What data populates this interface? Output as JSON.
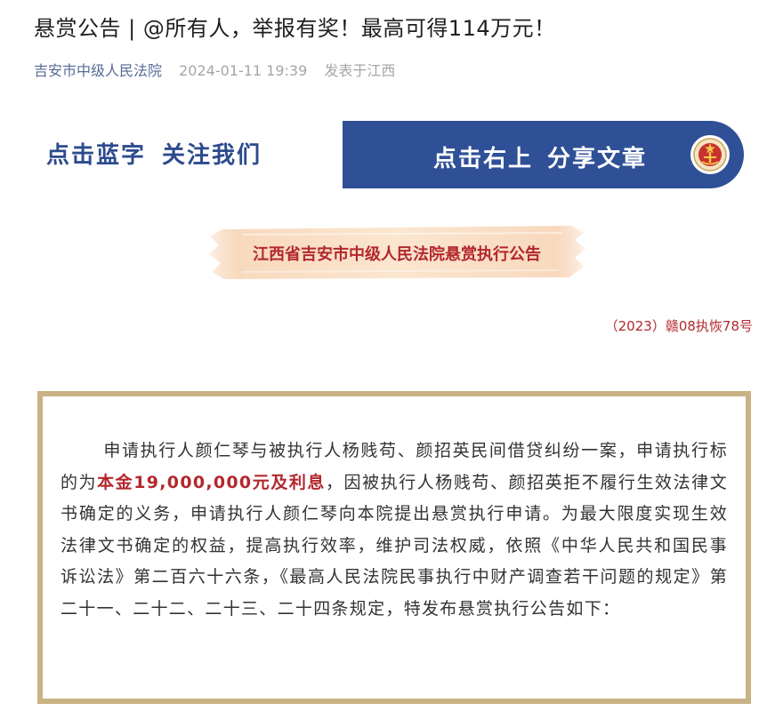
{
  "article": {
    "title": "悬赏公告 | @所有人，举报有奖！最高可得114万元！",
    "account": "吉安市中级人民法院",
    "datetime": "2024-01-11 19:39",
    "location": "发表于江西"
  },
  "banner": {
    "left_a": "点击蓝字",
    "left_b": "关注我们",
    "right_a": "点击右上",
    "right_b": "分享文章",
    "emblem_icon": "court-emblem-icon",
    "color_blue": "#2f5096"
  },
  "notice": {
    "heading": "江西省吉安市中级人民法院悬赏执行公告",
    "case_number": "（2023）赣08执恢78号"
  },
  "body": {
    "p1_before": "申请执行人颜仁琴与被执行人杨贱苟、颜招英民间借贷纠纷一案，申请执行标的为",
    "p1_highlight": "本金19,000,000元及利息",
    "p1_after": "，因被执行人杨贱苟、颜招英拒不履行生效法律文书确定的义务，申请执行人颜仁琴向本院提出悬赏执行申请。为最大限度实现生效法律文书确定的权益，提高执行效率，维护司法权威，依照《中华人民共和国民事诉讼法》第二百六十六条，《最高人民法院民事执行中财产调查若干问题的规定》第二十一、二十二、二十三、二十四条规定，特发布悬赏执行公告如下："
  }
}
